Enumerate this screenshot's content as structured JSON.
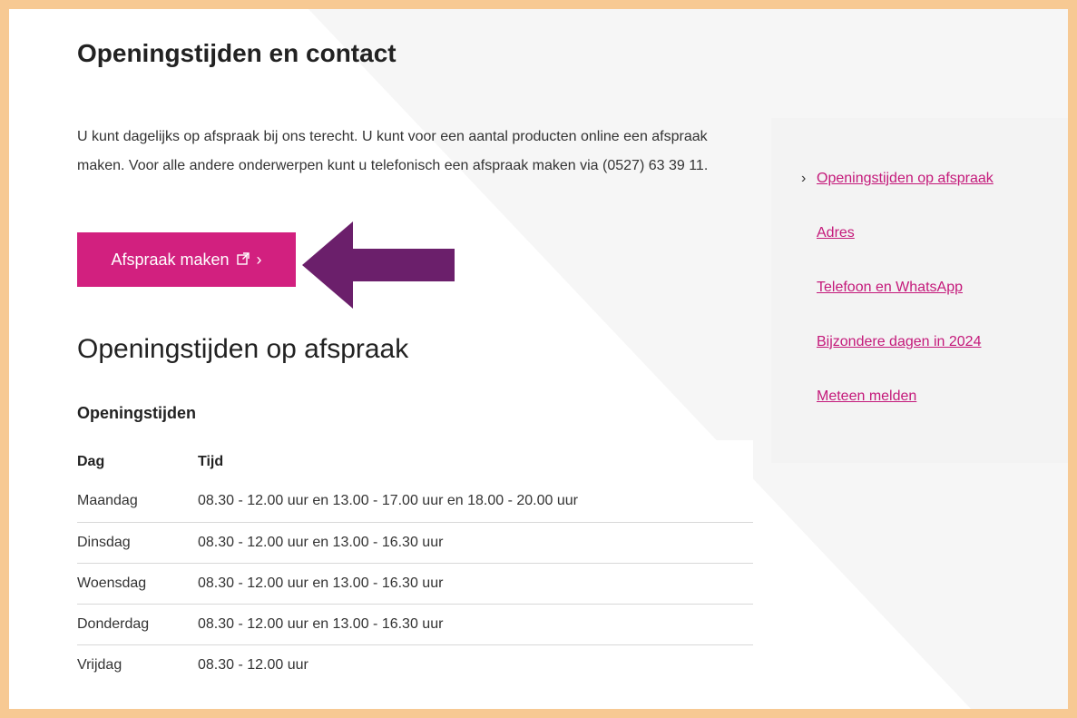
{
  "page": {
    "title": "Openingstijden en contact",
    "intro": "U kunt dagelijks op afspraak bij ons terecht. U kunt voor een aantal producten online een afspraak maken. Voor alle andere onderwerpen kunt u telefonisch een afspraak maken via (0527) 63 39 11.",
    "cta_label": "Afspraak maken",
    "cta_external_icon": "external-link-icon",
    "cta_chevron": "›"
  },
  "colors": {
    "accent": "#d2207f",
    "arrow": "#6b1f6b",
    "frame": "#f7c993",
    "link": "#c4197a"
  },
  "section": {
    "title": "Openingstijden op afspraak",
    "subtitle": "Openingstijden"
  },
  "table": {
    "headers": [
      "Dag",
      "Tijd"
    ],
    "rows": [
      [
        "Maandag",
        "08.30 - 12.00 uur en 13.00 - 17.00 uur en 18.00 - 20.00 uur"
      ],
      [
        "Dinsdag",
        "08.30 - 12.00 uur en 13.00 - 16.30 uur"
      ],
      [
        "Woensdag",
        "08.30 - 12.00 uur en 13.00 - 16.30 uur"
      ],
      [
        "Donderdag",
        "08.30 - 12.00 uur en 13.00 - 16.30 uur"
      ],
      [
        "Vrijdag",
        "08.30 - 12.00 uur"
      ]
    ]
  },
  "sidenav": {
    "items": [
      {
        "label": "Openingstijden op afspraak",
        "active": true
      },
      {
        "label": "Adres",
        "active": false
      },
      {
        "label": "Telefoon en WhatsApp",
        "active": false
      },
      {
        "label": "Bijzondere dagen in 2024",
        "active": false
      },
      {
        "label": "Meteen melden",
        "active": false
      }
    ],
    "active_marker": "›"
  }
}
